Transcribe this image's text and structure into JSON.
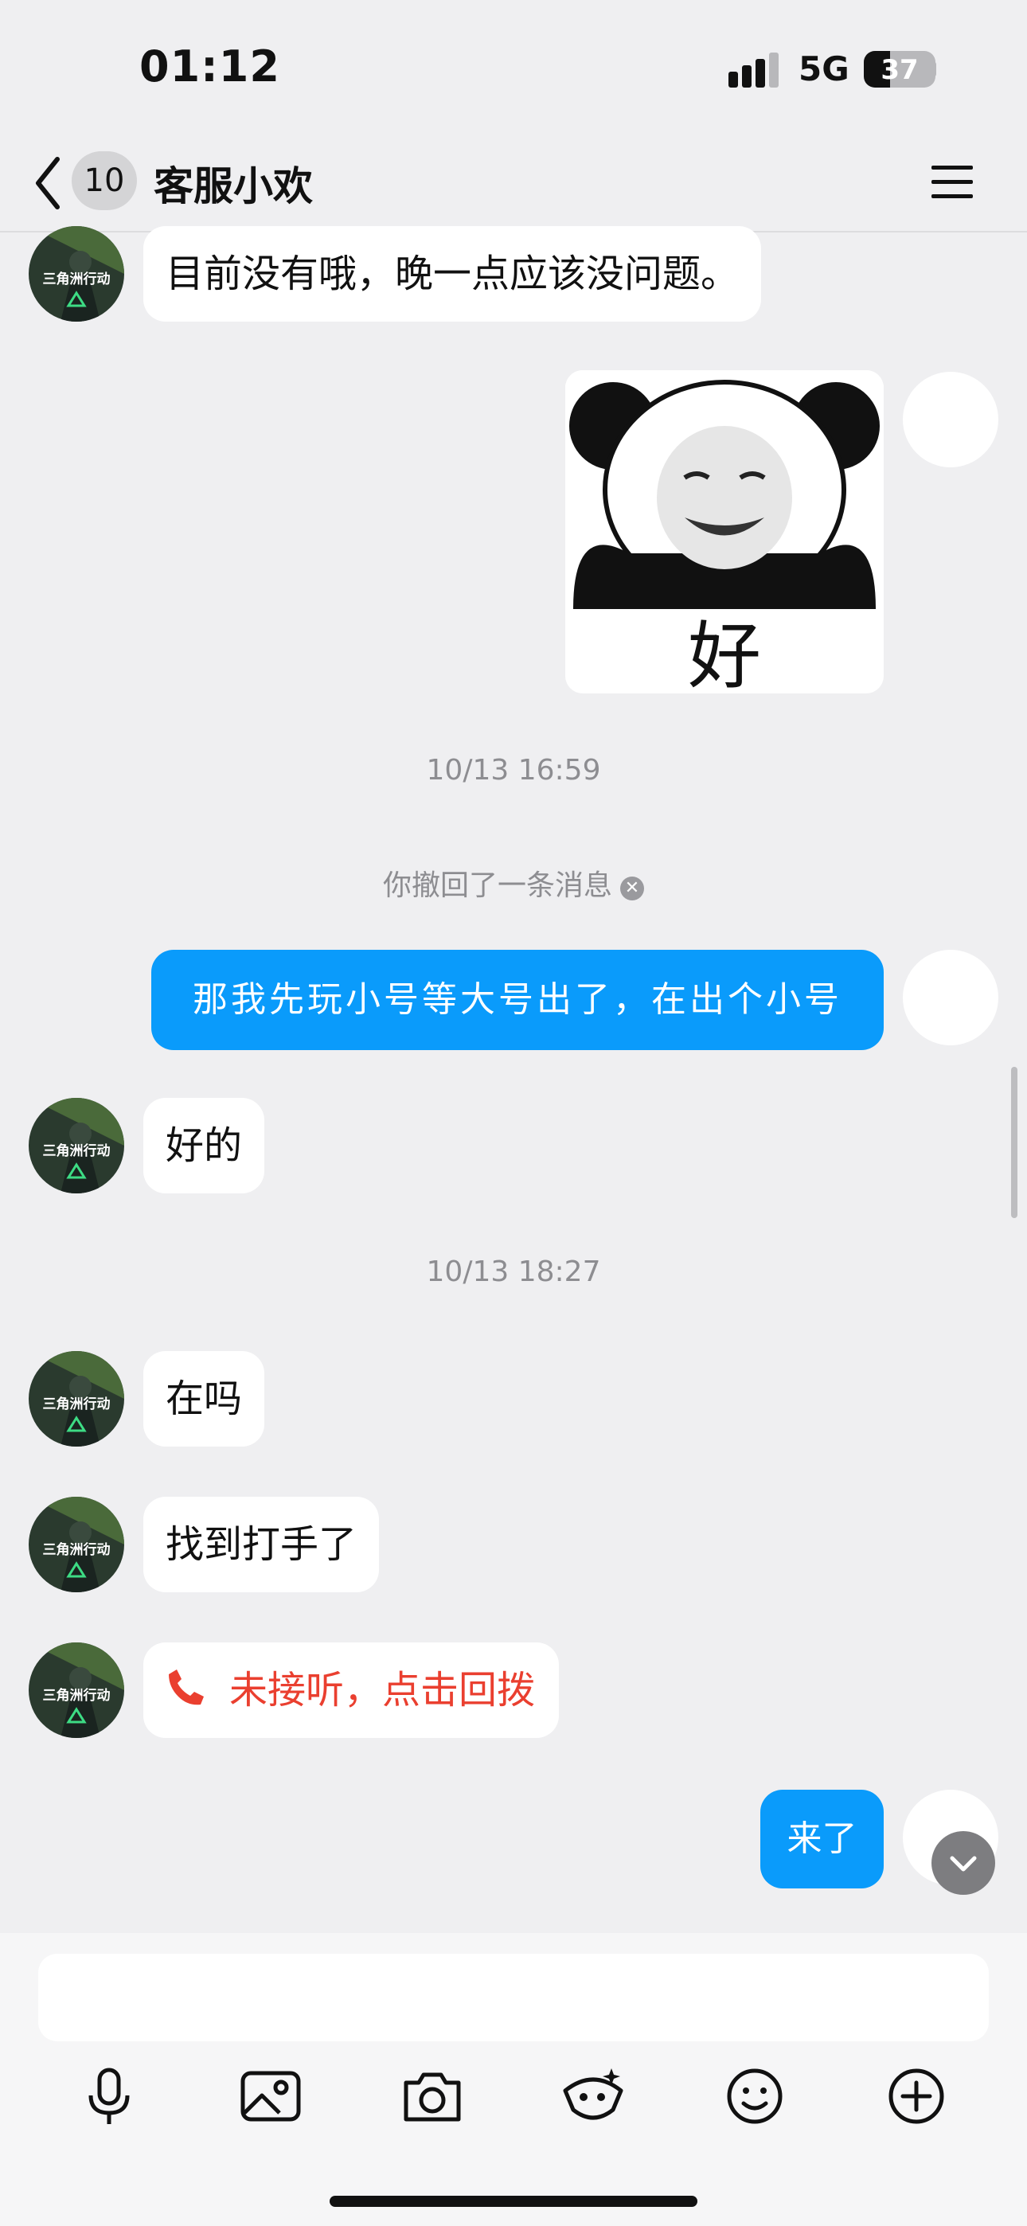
{
  "status_bar": {
    "time": "01:12",
    "network": "5G",
    "battery": "37",
    "battery_level": 0.37
  },
  "nav": {
    "unread_count": "10",
    "title": "客服小欢"
  },
  "messages": {
    "m1": "目前没有哦，晚一点应该没问题。",
    "sticker_text": "好",
    "ts1": "10/13 16:59",
    "recall": "你撤回了一条消息",
    "m2": "那我先玩小号等大号出了，在出个小号",
    "m3": "好的",
    "ts2": "10/13 18:27",
    "m4": "在吗",
    "m5": "找到打手了",
    "m6": "未接听，点击回拨",
    "m7": "来了"
  },
  "avatar_text": "三角洲行动",
  "input": {
    "placeholder": "",
    "value": ""
  },
  "toolbar": [
    "mic-icon",
    "image-icon",
    "camera-icon",
    "red-packet-icon",
    "emoji-icon",
    "plus-icon"
  ],
  "colors": {
    "accent": "#0a9bfb",
    "missed_call": "#ea3f2f",
    "background": "#efeff1"
  }
}
